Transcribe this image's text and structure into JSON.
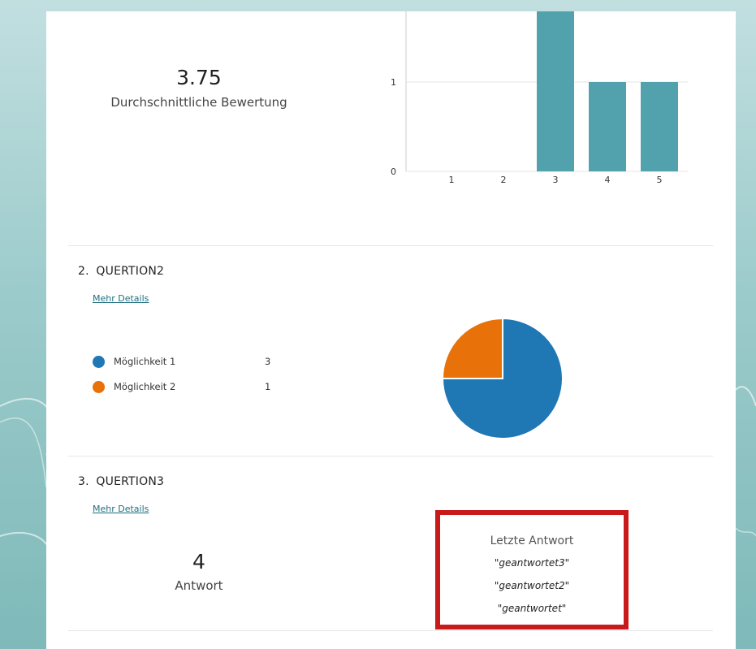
{
  "colors": {
    "bar": "#52a2ae",
    "option1": "#1f77b4",
    "option2": "#e8710a",
    "highlight_border": "#c8191b"
  },
  "q1": {
    "average": "3.75",
    "average_label": "Durchschnittliche Bewertung"
  },
  "chart_data": {
    "type": "bar",
    "categories": [
      "1",
      "2",
      "3",
      "4",
      "5"
    ],
    "values": [
      0,
      0,
      2,
      1,
      1
    ],
    "ylim": [
      0,
      2
    ],
    "yticks": [
      "0",
      "1"
    ],
    "grid": true
  },
  "q2": {
    "number": "2.",
    "title": "QUERTION2",
    "more_details": "Mehr Details",
    "options": [
      {
        "label": "Möglichkeit 1",
        "count": "3",
        "value": 3
      },
      {
        "label": "Möglichkeit 2",
        "count": "1",
        "value": 1
      }
    ]
  },
  "q3": {
    "number": "3.",
    "title": "QUERTION3",
    "more_details": "Mehr Details",
    "count": "4",
    "count_label": "Antwort",
    "latest_title": "Letzte Antwort",
    "latest": [
      "\"geantwortet3\"",
      "\"geantwortet2\"",
      "\"geantwortet\""
    ]
  }
}
